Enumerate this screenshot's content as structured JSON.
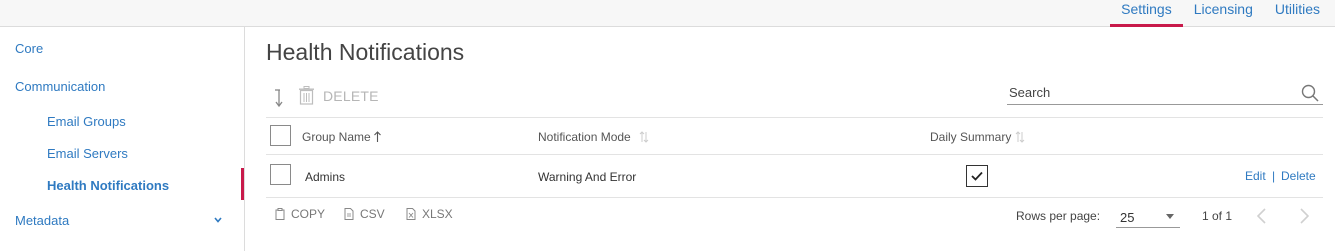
{
  "top_nav": {
    "tabs": [
      {
        "label": "Settings",
        "active": true
      },
      {
        "label": "Licensing",
        "active": false
      },
      {
        "label": "Utilities",
        "active": false
      }
    ]
  },
  "sidebar": {
    "items": [
      {
        "label": "Core"
      },
      {
        "label": "Communication"
      },
      {
        "label": "Metadata"
      }
    ],
    "sub_items": [
      {
        "label": "Email Groups"
      },
      {
        "label": "Email Servers"
      },
      {
        "label": "Health Notifications",
        "active": true
      }
    ]
  },
  "page": {
    "title": "Health Notifications",
    "toolbar": {
      "delete_label": "DELETE"
    },
    "search": {
      "label": "Search"
    }
  },
  "table": {
    "headers": [
      "Group Name",
      "Notification Mode",
      "Daily Summary"
    ],
    "sorted_column": "Group Name",
    "rows": [
      {
        "group_name": "Admins",
        "notification_mode": "Warning And Error",
        "daily_summary": true,
        "actions": {
          "edit": "Edit",
          "separator": "|",
          "delete": "Delete"
        }
      }
    ]
  },
  "footer": {
    "exports": [
      "COPY",
      "CSV",
      "XLSX"
    ],
    "rows_per_page_label": "Rows per page:",
    "rows_per_page_value": "25",
    "page_info": "1 of 1"
  },
  "colors": {
    "accent": "#2f7ac1",
    "active_marker": "#c8194a",
    "disabled": "#b6b6b6"
  }
}
